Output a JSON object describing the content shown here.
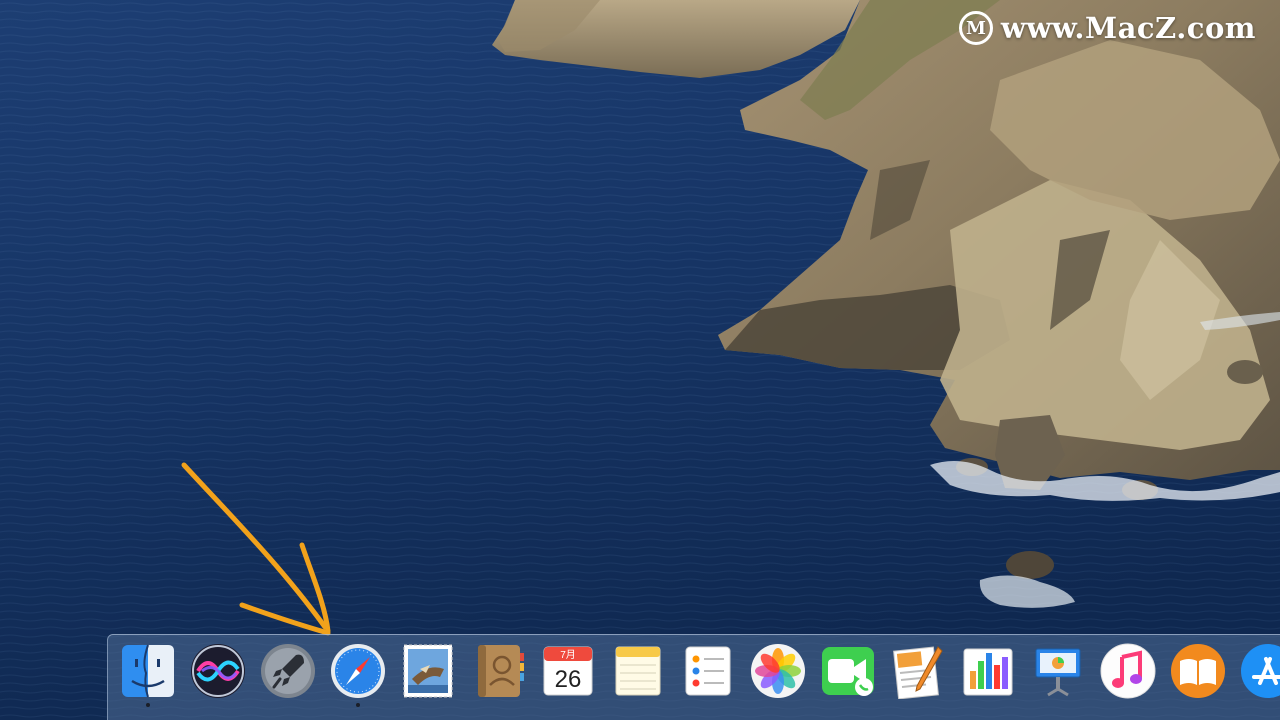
{
  "watermark": {
    "logo_letter": "M",
    "text": "www.MacZ.com"
  },
  "colors": {
    "annotation_arrow": "#f2a21b",
    "dock_background": "#506e96",
    "sea": "#1b3a6b"
  },
  "dock": {
    "items": [
      {
        "name": "finder",
        "icon": "finder-icon",
        "running": true
      },
      {
        "name": "siri",
        "icon": "siri-icon",
        "running": false
      },
      {
        "name": "launchpad",
        "icon": "launchpad-rocket-icon",
        "running": false
      },
      {
        "name": "safari",
        "icon": "safari-compass-icon",
        "running": true
      },
      {
        "name": "mail",
        "icon": "mail-stamp-icon",
        "running": false
      },
      {
        "name": "contacts",
        "icon": "contacts-book-icon",
        "running": false
      },
      {
        "name": "calendar",
        "icon": "calendar-icon",
        "running": false
      },
      {
        "name": "notes",
        "icon": "notes-icon",
        "running": false
      },
      {
        "name": "reminders",
        "icon": "reminders-icon",
        "running": false
      },
      {
        "name": "photos",
        "icon": "photos-flower-icon",
        "running": false
      },
      {
        "name": "facetime",
        "icon": "facetime-camera-icon",
        "running": false
      },
      {
        "name": "pages",
        "icon": "pages-pen-icon",
        "running": false
      },
      {
        "name": "numbers",
        "icon": "numbers-chart-icon",
        "running": false
      },
      {
        "name": "keynote",
        "icon": "keynote-podium-icon",
        "running": false
      },
      {
        "name": "music",
        "icon": "music-note-icon",
        "running": false
      },
      {
        "name": "books",
        "icon": "books-open-book-icon",
        "running": false
      },
      {
        "name": "app-store",
        "icon": "app-store-icon",
        "running": false
      }
    ],
    "calendar": {
      "month": "7月",
      "day": "26"
    }
  }
}
